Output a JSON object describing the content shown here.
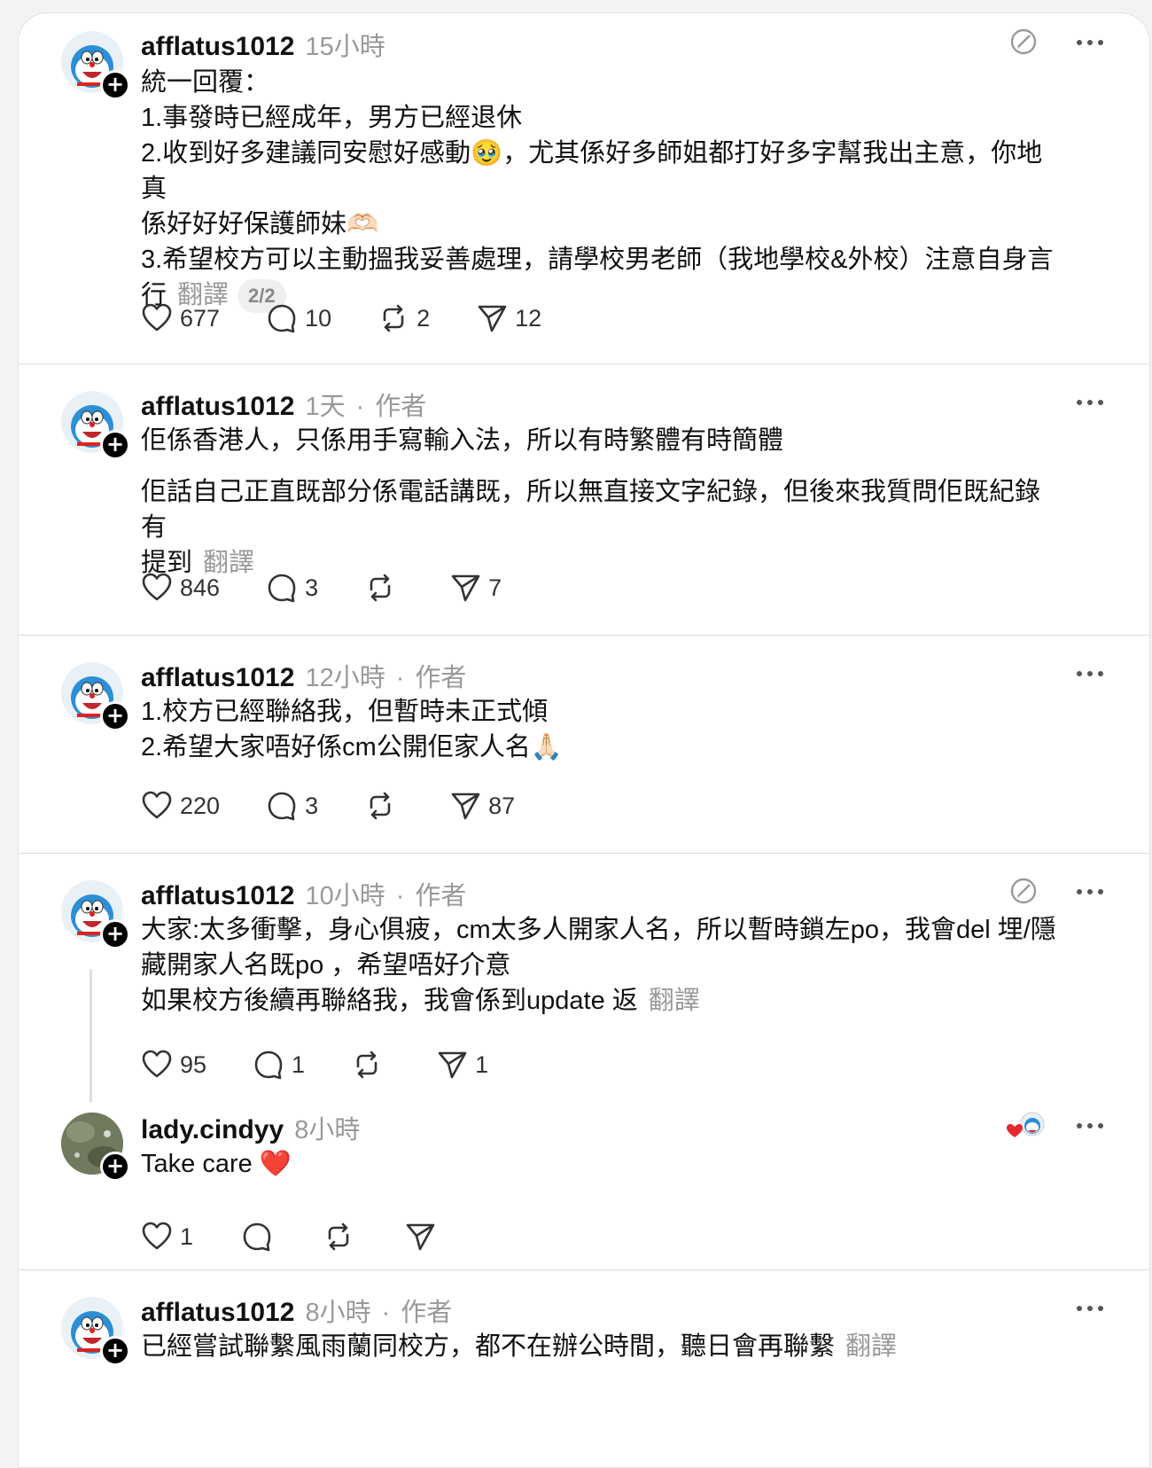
{
  "posts": [
    {
      "username": "afflatus1012",
      "time": "15小時",
      "lines": [
        "統一回覆：",
        "1.事發時已經成年，男方已經退休",
        "2.收到好多建議同安慰好感動🥹，尤其係好多師姐都打好多字幫我出主意，你地真",
        "係好好好保護師妹🫶🏻",
        "3.希望校方可以主動搵我妥善處理，請學校男老師（我地學校&外校）注意自身言",
        "行"
      ],
      "translate": "翻譯",
      "pager": "2/2",
      "likes": "677",
      "comments": "10",
      "reposts": "2",
      "shares": "12"
    },
    {
      "username": "afflatus1012",
      "time": "1天",
      "dot": "·",
      "author": "作者",
      "para1": "佢係香港人，只係用手寫輸入法，所以有時繁體有時簡體",
      "para2_line1": "佢話自己正直既部分係電話講既，所以無直接文字紀錄，但後來我質問佢既紀錄有",
      "para2_line2": "提到",
      "translate": "翻譯",
      "likes": "846",
      "comments": "3",
      "shares": "7"
    },
    {
      "username": "afflatus1012",
      "time": "12小時",
      "dot": "·",
      "author": "作者",
      "lines": [
        "1.校方已經聯絡我，但暫時未正式傾",
        "2.希望大家唔好係cm公開佢家人名🙏🏻"
      ],
      "likes": "220",
      "comments": "3",
      "shares": "87"
    },
    {
      "username": "afflatus1012",
      "time": "10小時",
      "dot": "·",
      "author": "作者",
      "lines": [
        "大家:太多衝擊，身心俱疲，cm太多人開家人名，所以暫時鎖左po，我會del 埋/隱",
        "藏開家人名既po ，希望唔好介意",
        "如果校方後續再聯絡我，我會係到update 返"
      ],
      "translate": "翻譯",
      "likes": "95",
      "comments": "1",
      "shares": "1"
    },
    {
      "username": "lady.cindyy",
      "time": "8小時",
      "text": "Take care ❤️",
      "likes": "1"
    },
    {
      "username": "afflatus1012",
      "time": "8小時",
      "dot": "·",
      "author": "作者",
      "text": "已經嘗試聯繫風雨蘭同校方，都不在辦公時間，聽日會再聯繫",
      "translate": "翻譯"
    }
  ],
  "icons": {
    "heart": "heart-icon",
    "comment": "comment-icon",
    "repost": "repost-icon",
    "share": "share-icon",
    "more": "more-icon",
    "edit": "edit-icon"
  },
  "colors": {
    "muted": "#999999",
    "text": "#111111",
    "divider": "#dddddd",
    "accent_red": "#e8262e"
  }
}
